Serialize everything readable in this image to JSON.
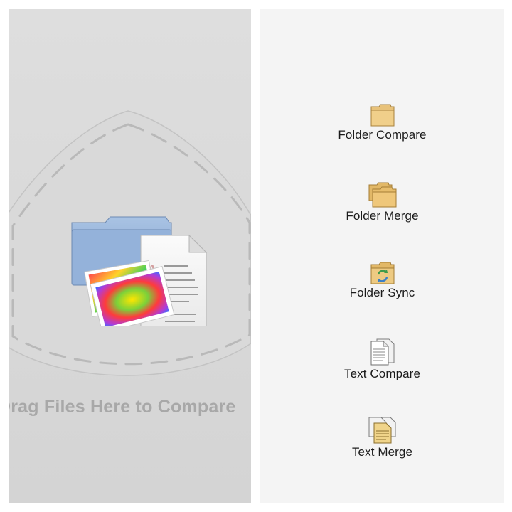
{
  "drop_area": {
    "label": "Drag Files Here to Compare",
    "hero_icon": "files-and-folder-icon"
  },
  "actions": [
    {
      "id": "folder-compare",
      "label": "Folder Compare",
      "icon": "folder-icon"
    },
    {
      "id": "folder-merge",
      "label": "Folder Merge",
      "icon": "folder-merge-icon"
    },
    {
      "id": "folder-sync",
      "label": "Folder Sync",
      "icon": "folder-sync-icon"
    },
    {
      "id": "text-compare",
      "label": "Text Compare",
      "icon": "documents-icon"
    },
    {
      "id": "text-merge",
      "label": "Text Merge",
      "icon": "documents-merge-icon"
    }
  ],
  "colors": {
    "drop_bg": "#d8d8d8",
    "drop_label": "#a8a8a8",
    "panel_bg": "#f4f4f4",
    "label_text": "#1b1b1b",
    "folder_tan": "#e2b867"
  }
}
